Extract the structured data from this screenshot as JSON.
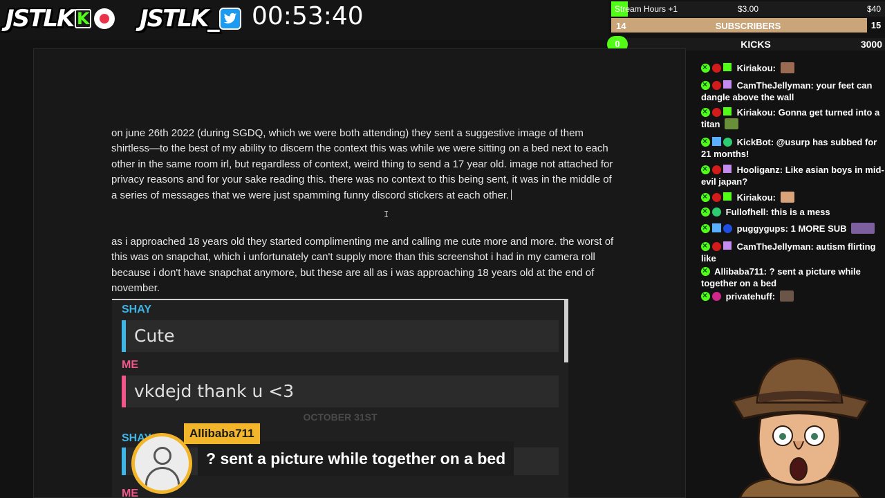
{
  "header": {
    "logo_text_1": "JSTLK",
    "kick_letter": "K",
    "logo_text_2": "JSTLK_",
    "timer": "00:53:40"
  },
  "goals": {
    "hours_label": "Stream Hours +1",
    "hours_mid": "$3.00",
    "hours_max": "$40",
    "hours_progress": 0.06,
    "subs_current": "14",
    "subs_label": "SUBSCRIBERS",
    "subs_max": "15",
    "kicks_current": "0",
    "kicks_label": "KICKS",
    "kicks_max": "3000",
    "colors": {
      "kick_green": "#53fc18",
      "subs_gold": "#caa57a"
    }
  },
  "document": {
    "paragraph_1": "on june 26th 2022 (during SGDQ, which we were both attending) they sent a suggestive image of them shirtless—to the best of my ability to discern the context this was while we were sitting on a bed next to each other in the same room irl, but regardless of context, weird thing to send a 17 year old. image not attached for privacy reasons and for your sake reading this. there was no context to this being sent, it was in the middle of a series of messages that we were just spamming funny discord stickers at each other.",
    "paragraph_2": "as i approached 18 years old they started complimenting me and calling me cute more and more. the worst of this was on snapchat, which i unfortunately can't supply more than this screenshot i had in my camera roll because i don't have snapchat anymore, but these are all as i was approaching 18 years old at the end of november."
  },
  "snapchat": {
    "sender_1": "SHAY",
    "message_1": "Cute",
    "sender_2": "ME",
    "message_2": "vkdejd thank u <3",
    "date_separator": "OCTOBER 31ST",
    "sender_3": "SHAY",
    "sender_4": "ME"
  },
  "chat": {
    "messages": [
      {
        "user": "Kiriakou:",
        "text": ""
      },
      {
        "user": "CamTheJellyman:",
        "text": "your feet can dangle above the wall"
      },
      {
        "user": "Kiriakou:",
        "text": "Gonna get turned into a titan"
      },
      {
        "user": "KickBot:",
        "text": "@usurp has subbed for 21 months!"
      },
      {
        "user": "Hooliganz:",
        "text": "Like asian boys in mid-evil japan?"
      },
      {
        "user": "Kiriakou:",
        "text": ""
      },
      {
        "user": "Fullofhell:",
        "text": "this is a mess"
      },
      {
        "user": "puggygups:",
        "text": "1 MORE SUB"
      },
      {
        "user": "CamTheJellyman:",
        "text": "autism flirting like"
      },
      {
        "user": "Allibaba711:",
        "text": "? sent a picture while together on a bed"
      },
      {
        "user": "privatehuff:",
        "text": ""
      }
    ]
  },
  "highlight": {
    "username": "Allibaba711",
    "message": "? sent a picture while together on a bed"
  },
  "icons": [
    "record-icon",
    "twitter-icon",
    "kick-badge-icon",
    "gift-sub-icon",
    "moderator-icon",
    "avatar-placeholder-icon",
    "text-cursor-icon"
  ]
}
